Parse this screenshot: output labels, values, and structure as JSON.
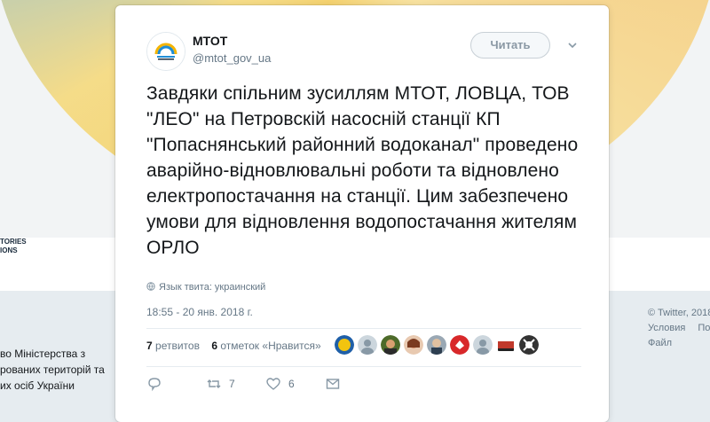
{
  "background": {
    "logo_lines": [
      "TORIES",
      "IONS"
    ],
    "left_text_lines": [
      "во Міністерства з",
      "рованих територій та",
      "их осіб України"
    ],
    "footer": {
      "copyright": "© Twitter, 2018",
      "links": [
        "Условия",
        "Пол"
      ],
      "third": "Файл"
    }
  },
  "tweet": {
    "author_name": "МТОТ",
    "author_handle": "@mtot_gov_ua",
    "follow_label": "Читать",
    "text": "Завдяки спільним зусиллям МТОТ, ЛОВЦА, ТОВ \"ЛЕО\" на Петровскій  насосній станції КП \"Попаснянський районний водоканал\" проведено аварійно-відновлювальні роботи та відновлено електропостачання на станції. Цим забезпечено умови для відновлення водопостачання жителям ОРЛО",
    "language_note": "Язык твита: украинский",
    "timestamp": "18:55 - 20 янв. 2018 г.",
    "retweets_count": "7",
    "retweets_label": "ретвитов",
    "likes_count": "6",
    "likes_label": "отметок «Нравится»",
    "actions": {
      "reply_count": "",
      "retweet_count": "7",
      "like_count": "6"
    }
  },
  "likers": [
    {
      "name": "liker-1",
      "color": "#f2c40f"
    },
    {
      "name": "liker-2",
      "color": "#b8c4cc"
    },
    {
      "name": "liker-3",
      "color": "#6b5a2a"
    },
    {
      "name": "liker-4",
      "color": "#d9a070"
    },
    {
      "name": "liker-5",
      "color": "#7c8a96"
    },
    {
      "name": "liker-6",
      "color": "#d8282a"
    },
    {
      "name": "liker-7",
      "color": "#b8c4cc"
    },
    {
      "name": "liker-8",
      "color": "#c0392b"
    },
    {
      "name": "liker-9",
      "color": "#333333"
    }
  ],
  "colors": {
    "text": "#14171a",
    "muted": "#657786",
    "border": "#e6ecf0"
  }
}
